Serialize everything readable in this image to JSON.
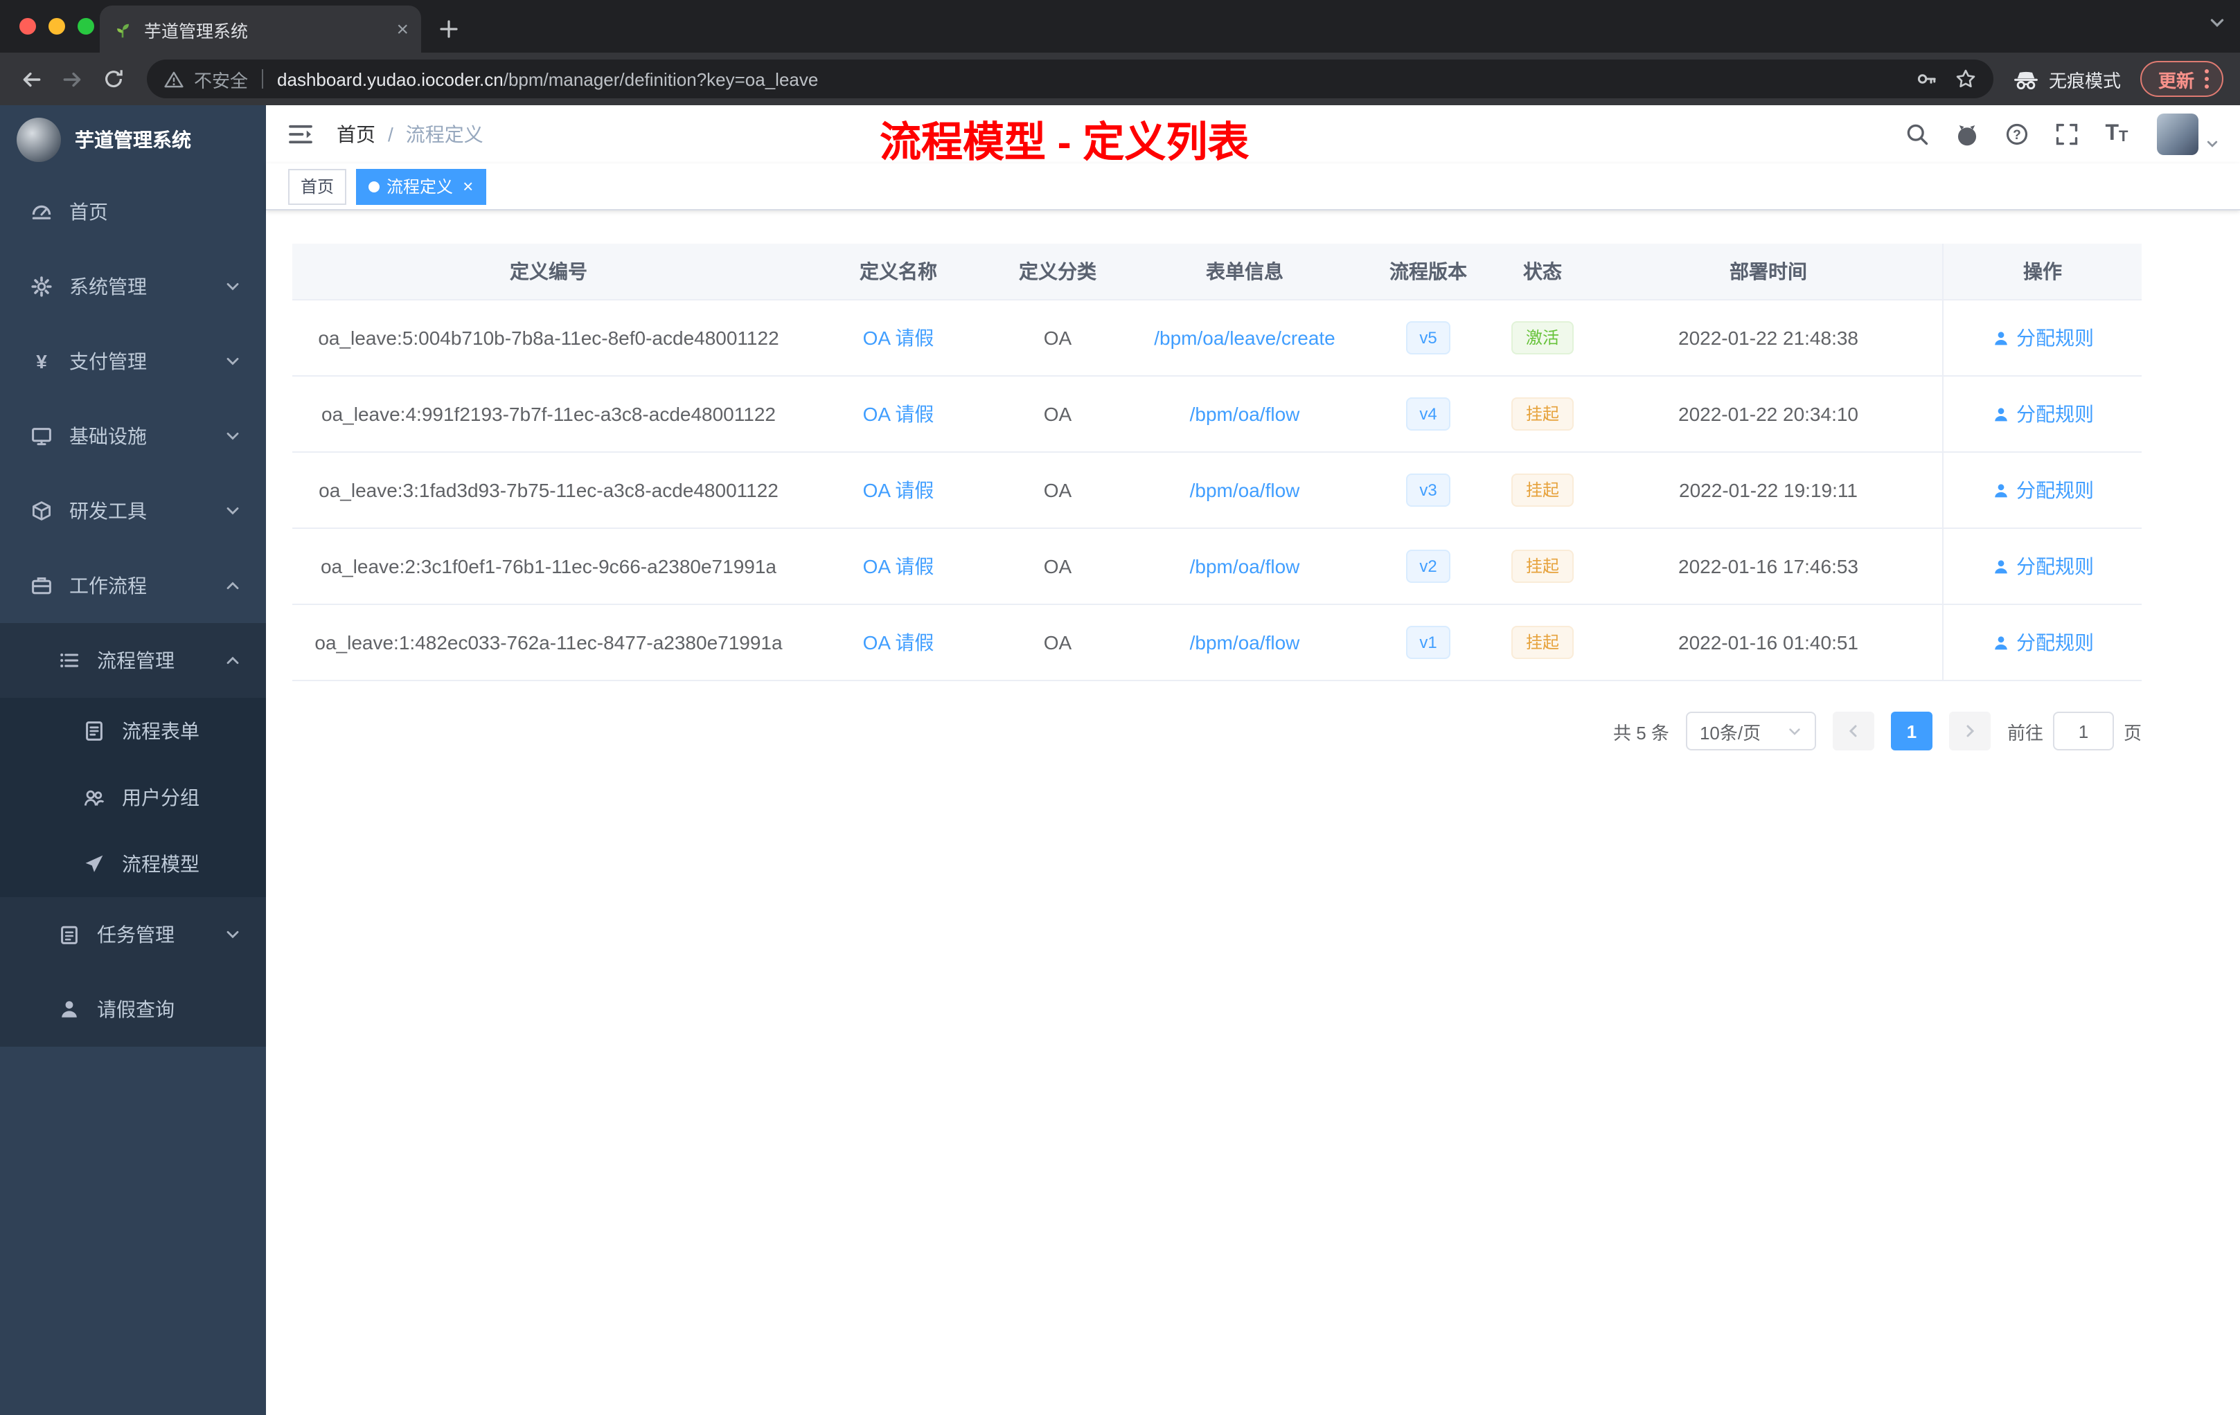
{
  "colors": {
    "primary": "#409EFF",
    "success": "#67C23A",
    "warning": "#E6A23C",
    "annotation_red": "#FF0000",
    "sidebar_bg": "#304156"
  },
  "glyphs": {
    "close": "×",
    "plus": "+",
    "yen": "¥",
    "breadcrumb_separator": "/",
    "question": "?",
    "fontsize": "T",
    "active_dot": ""
  },
  "browser": {
    "tab_title": "芋道管理系统",
    "security_label": "不安全",
    "url_host": "dashboard.yudao.iocoder.cn",
    "url_path": "/bpm/manager/definition?key=oa_leave",
    "incognito_label": "无痕模式",
    "update_label": "更新"
  },
  "sidebar": {
    "logo_title": "芋道管理系统",
    "menu": [
      {
        "label": "首页"
      },
      {
        "label": "系统管理"
      },
      {
        "label": "支付管理"
      },
      {
        "label": "基础设施"
      },
      {
        "label": "研发工具"
      },
      {
        "label": "工作流程"
      }
    ],
    "submenu": [
      {
        "label": "流程管理",
        "children": [
          "流程表单",
          "用户分组",
          "流程模型"
        ]
      },
      {
        "label": "任务管理"
      },
      {
        "label": "请假查询"
      }
    ]
  },
  "header": {
    "breadcrumb_home": "首页",
    "breadcrumb_current": "流程定义",
    "annotation": "流程模型 - 定义列表"
  },
  "tags_bar": {
    "tags": [
      {
        "label": "首页",
        "active": false
      },
      {
        "label": "流程定义",
        "active": true
      }
    ]
  },
  "table": {
    "columns": [
      "定义编号",
      "定义名称",
      "定义分类",
      "表单信息",
      "流程版本",
      "状态",
      "部署时间",
      "操作"
    ],
    "rows": [
      {
        "id": "oa_leave:5:004b710b-7b8a-11ec-8ef0-acde48001122",
        "name": "OA 请假",
        "category": "OA",
        "form": "/bpm/oa/leave/create",
        "version": "v5",
        "status": "激活",
        "status_type": "success",
        "deployed": "2022-01-22 21:48:38",
        "action": "分配规则"
      },
      {
        "id": "oa_leave:4:991f2193-7b7f-11ec-a3c8-acde48001122",
        "name": "OA 请假",
        "category": "OA",
        "form": "/bpm/oa/flow",
        "version": "v4",
        "status": "挂起",
        "status_type": "warning",
        "deployed": "2022-01-22 20:34:10",
        "action": "分配规则"
      },
      {
        "id": "oa_leave:3:1fad3d93-7b75-11ec-a3c8-acde48001122",
        "name": "OA 请假",
        "category": "OA",
        "form": "/bpm/oa/flow",
        "version": "v3",
        "status": "挂起",
        "status_type": "warning",
        "deployed": "2022-01-22 19:19:11",
        "action": "分配规则"
      },
      {
        "id": "oa_leave:2:3c1f0ef1-76b1-11ec-9c66-a2380e71991a",
        "name": "OA 请假",
        "category": "OA",
        "form": "/bpm/oa/flow",
        "version": "v2",
        "status": "挂起",
        "status_type": "warning",
        "deployed": "2022-01-16 17:46:53",
        "action": "分配规则"
      },
      {
        "id": "oa_leave:1:482ec033-762a-11ec-8477-a2380e71991a",
        "name": "OA 请假",
        "category": "OA",
        "form": "/bpm/oa/flow",
        "version": "v1",
        "status": "挂起",
        "status_type": "warning",
        "deployed": "2022-01-16 01:40:51",
        "action": "分配规则"
      }
    ]
  },
  "pagination": {
    "total": "共 5 条",
    "page_size": "10条/页",
    "page": "1",
    "goto_label": "前往",
    "goto_value": "1",
    "unit_label": "页"
  }
}
